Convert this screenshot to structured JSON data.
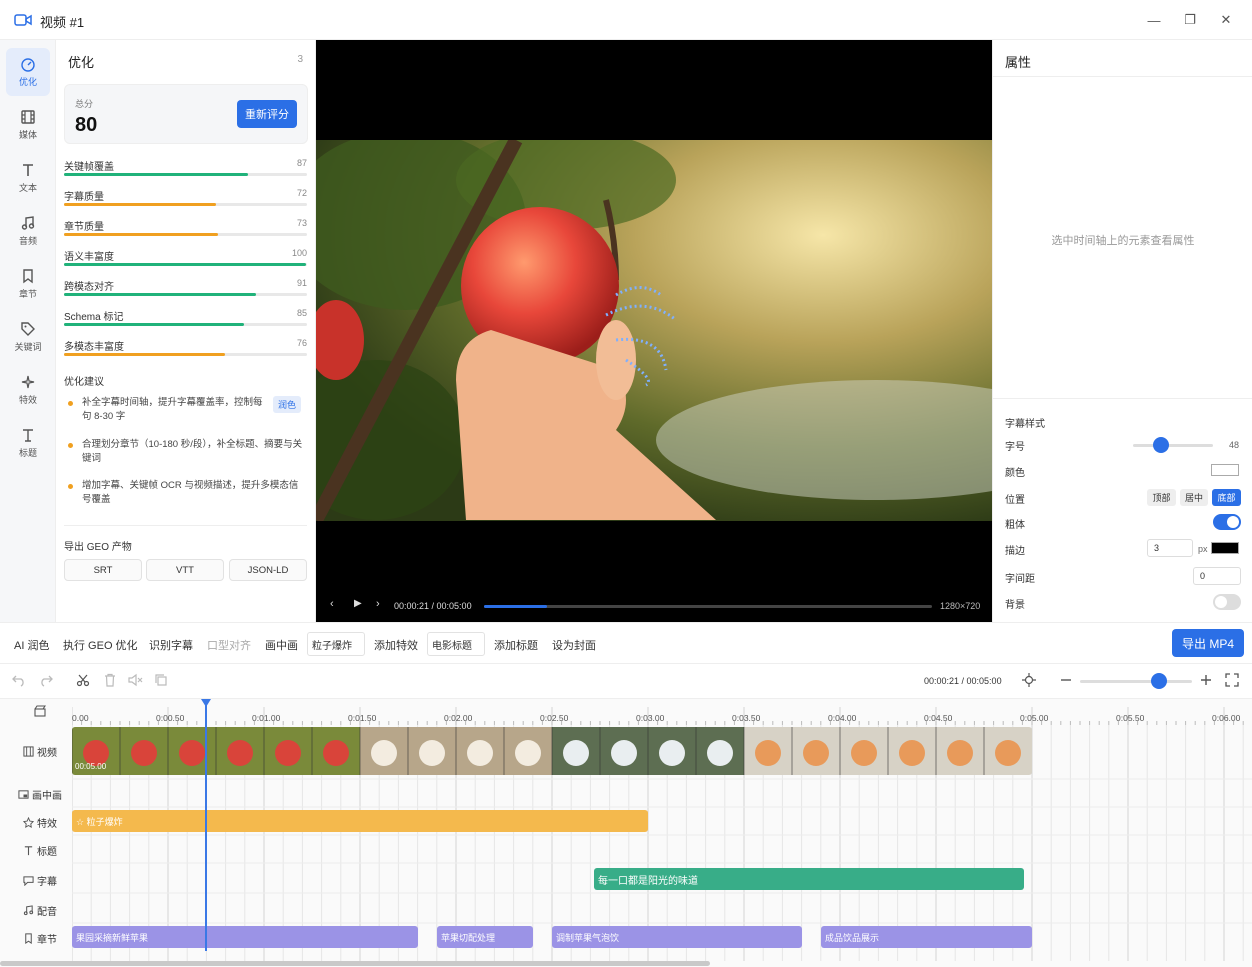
{
  "window": {
    "title": "视频 #1",
    "controls": [
      "—",
      "❐",
      "✕"
    ]
  },
  "rail": [
    {
      "label": "优化",
      "icon": "gauge-icon",
      "active": true
    },
    {
      "label": "媒体",
      "icon": "film-icon"
    },
    {
      "label": "文本",
      "icon": "text-icon"
    },
    {
      "label": "音频",
      "icon": "music-icon"
    },
    {
      "label": "章节",
      "icon": "bookmark-icon"
    },
    {
      "label": "关键词",
      "icon": "tag-icon"
    },
    {
      "label": "特效",
      "icon": "sparkle-icon"
    },
    {
      "label": "标题",
      "icon": "title-icon"
    }
  ],
  "optimize": {
    "header": "优化",
    "count": "3",
    "score_label": "总分",
    "score": "80",
    "rescore_label": "重新评分",
    "metrics": [
      {
        "name": "关键帧覆盖",
        "value": 87,
        "color": "#20b27a"
      },
      {
        "name": "字幕质量",
        "value": 72,
        "color": "#f0a020"
      },
      {
        "name": "章节质量",
        "value": 73,
        "color": "#f0a020"
      },
      {
        "name": "语义丰富度",
        "value": 100,
        "color": "#20b27a"
      },
      {
        "name": "跨模态对齐",
        "value": 91,
        "color": "#20b27a"
      },
      {
        "name": "Schema 标记",
        "value": 85,
        "color": "#20b27a"
      },
      {
        "name": "多模态丰富度",
        "value": 76,
        "color": "#f0a020"
      }
    ],
    "suggest_title": "优化建议",
    "suggestions": [
      "补全字幕时间轴，提升字幕覆盖率，控制每句 8-30 字",
      "合理划分章节（10-180 秒/段），补全标题、摘要与关键词",
      "增加字幕、关键帧 OCR 与视频描述，提升多模态信号覆盖"
    ],
    "suggest_tag": "润色",
    "geo_title": "导出 GEO 产物",
    "geo_buttons": [
      "SRT",
      "VTT",
      "JSON-LD"
    ]
  },
  "player": {
    "time": "00:00:21 / 00:05:00",
    "progress": 0.14,
    "resolution": "1280×720"
  },
  "properties": {
    "header": "属性",
    "empty_hint": "选中时间轴上的元素查看属性",
    "subtitle_style": "字幕样式",
    "font_size_label": "字号",
    "font_size": "48",
    "color_label": "颜色",
    "position_label": "位置",
    "positions": [
      "顶部",
      "居中",
      "底部"
    ],
    "position_selected": "底部",
    "bold_label": "粗体",
    "bold": true,
    "stroke_label": "描边",
    "stroke_width": "3",
    "stroke_unit": "px",
    "letter_spacing_label": "字间距",
    "letter_spacing": "0",
    "background_label": "背景",
    "background": false,
    "accent": "#2b6fe6"
  },
  "toolbar": {
    "items": [
      "AI 润色",
      "执行 GEO 优化",
      "识别字幕",
      "口型对齐",
      "画中画",
      "添加特效",
      "添加标题",
      "设为封面"
    ],
    "effect_select": "粒子爆炸",
    "title_select": "电影标题",
    "export_label": "导出 MP4"
  },
  "timeline": {
    "time": "00:00:21 / 00:05:00",
    "ruler": [
      "0.00",
      "0:00.50",
      "0:01.00",
      "0:01.50",
      "0:02.00",
      "0:02.50",
      "0:03.00",
      "0:03.50",
      "0:04.00",
      "0:04.50",
      "0:05.00",
      "0:05.50",
      "0:06.00"
    ],
    "tracks": [
      "视频",
      "画中画",
      "特效",
      "标题",
      "字幕",
      "配音",
      "章节"
    ],
    "video_clip_duration": "00:05.00",
    "effect_clip": "☆ 粒子爆炸",
    "subtitle_clip": "每一口都是阳光的味道",
    "chapters": [
      "果园采摘新鲜苹果",
      "苹果切配处理",
      "调制苹果气泡饮",
      "成品饮品展示"
    ]
  }
}
